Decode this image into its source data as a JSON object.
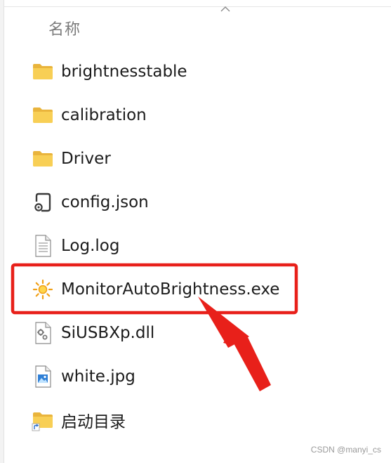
{
  "header": {
    "name_column": "名称"
  },
  "files": [
    {
      "name": "brightnesstable",
      "icon": "folder-icon"
    },
    {
      "name": "calibration",
      "icon": "folder-icon"
    },
    {
      "name": "Driver",
      "icon": "folder-icon"
    },
    {
      "name": "config.json",
      "icon": "json-file-icon"
    },
    {
      "name": "Log.log",
      "icon": "text-file-icon"
    },
    {
      "name": "MonitorAutoBrightness.exe",
      "icon": "sun-icon",
      "highlighted": true
    },
    {
      "name": "SiUSBXp.dll",
      "icon": "dll-file-icon"
    },
    {
      "name": "white.jpg",
      "icon": "image-file-icon"
    },
    {
      "name": "启动目录",
      "icon": "folder-shortcut-icon"
    }
  ],
  "annotation": {
    "box_color": "#e8201a",
    "arrow_color": "#e8201a"
  },
  "colors": {
    "folder": "#f6c84c",
    "sun": "#f2a21e"
  },
  "watermark": "CSDN @manyi_cs"
}
